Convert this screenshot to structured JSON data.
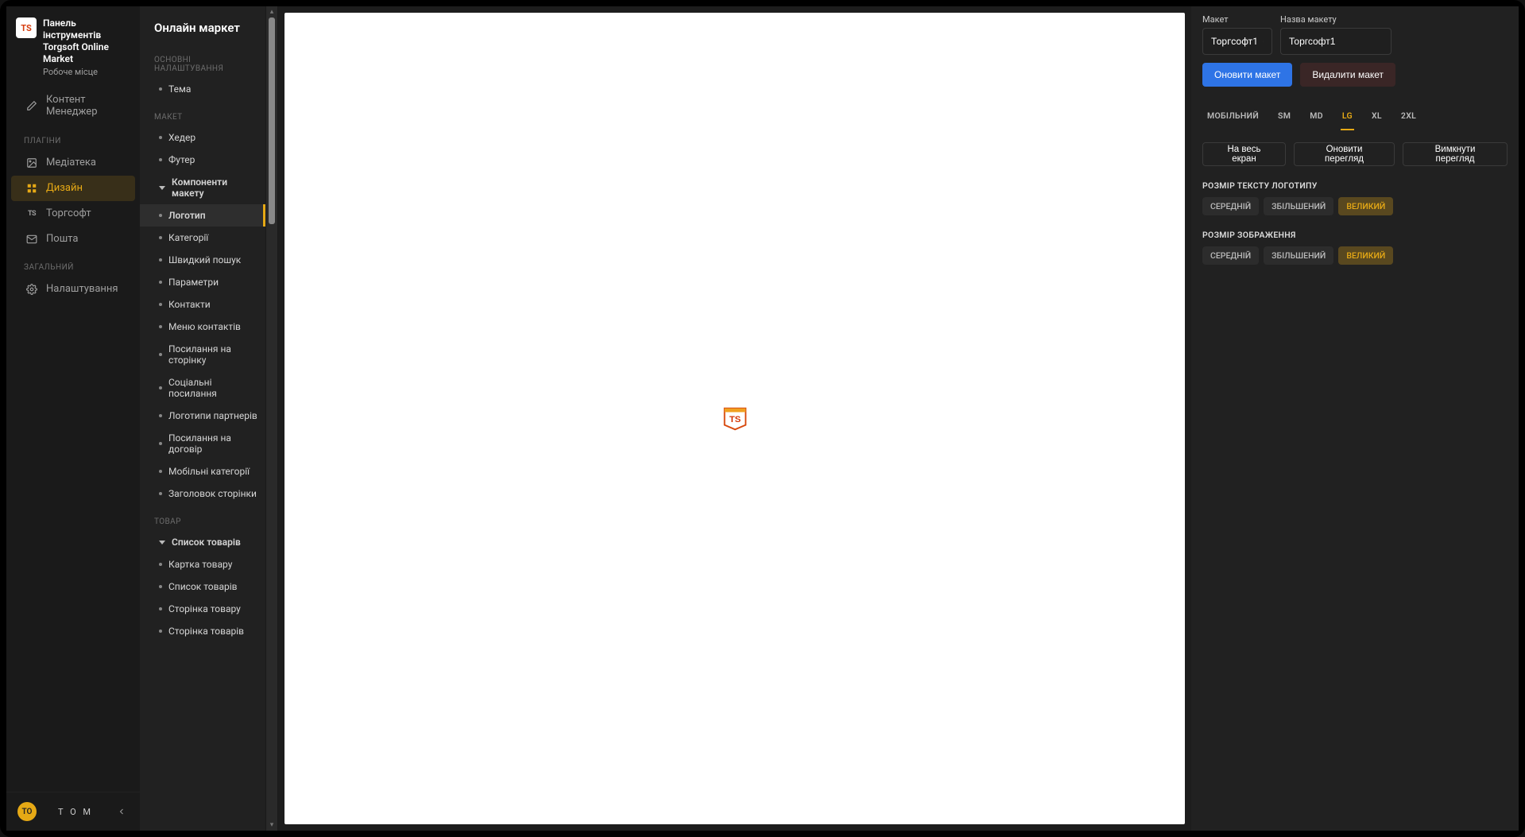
{
  "brand": {
    "logo_text": "TS",
    "title": "Панель інструментів Torgsoft Online Market",
    "subtitle": "Робоче місце"
  },
  "nav_top": {
    "content_manager": "Контент Менеджер"
  },
  "nav_sections": [
    {
      "label": "ПЛАГІНИ",
      "items": [
        {
          "id": "media",
          "label": "Медіатека",
          "icon": "image-icon"
        },
        {
          "id": "design",
          "label": "Дизайн",
          "icon": "layout-icon",
          "active": true
        },
        {
          "id": "torgsoft",
          "label": "Торгсофт",
          "icon": "ts-icon"
        },
        {
          "id": "mail",
          "label": "Пошта",
          "icon": "mail-icon"
        }
      ]
    },
    {
      "label": "ЗАГАЛЬНИЙ",
      "items": [
        {
          "id": "settings",
          "label": "Налаштування",
          "icon": "gear-icon"
        }
      ]
    }
  ],
  "user": {
    "initials": "TO",
    "name": "T O M"
  },
  "subnav": {
    "title": "Онлайн маркет",
    "groups": [
      {
        "label": "ОСНОВНІ НАЛАШТУВАННЯ",
        "items": [
          {
            "id": "theme",
            "label": "Тема"
          }
        ]
      },
      {
        "label": "МАКЕТ",
        "items": [
          {
            "id": "header",
            "label": "Хедер"
          },
          {
            "id": "footer",
            "label": "Футер"
          }
        ]
      },
      {
        "label": "",
        "expandable_header": "Компоненти макету",
        "items": [
          {
            "id": "logo",
            "label": "Логотип",
            "active": true
          },
          {
            "id": "categories",
            "label": "Категорії"
          },
          {
            "id": "quicksearch",
            "label": "Швидкий пошук"
          },
          {
            "id": "params",
            "label": "Параметри"
          },
          {
            "id": "contacts",
            "label": "Контакти"
          },
          {
            "id": "contactmenu",
            "label": "Меню контактів"
          },
          {
            "id": "pagelink",
            "label": "Посилання на сторінку"
          },
          {
            "id": "social",
            "label": "Соціальні посилання"
          },
          {
            "id": "partners",
            "label": "Логотипи партнерів"
          },
          {
            "id": "contract",
            "label": "Посилання на договір"
          },
          {
            "id": "mobcats",
            "label": "Мобільні категорії"
          },
          {
            "id": "pagetitle",
            "label": "Заголовок сторінки"
          }
        ]
      },
      {
        "label": "ТОВАР",
        "expandable_header": "Список товарів",
        "items": [
          {
            "id": "prodcard",
            "label": "Картка товару"
          },
          {
            "id": "prodlist",
            "label": "Список товарів"
          },
          {
            "id": "prodpage",
            "label": "Сторінка товару"
          },
          {
            "id": "prodspage",
            "label": "Сторінка товарів"
          }
        ]
      }
    ]
  },
  "preview": {
    "logo_text": "TS"
  },
  "rightpanel": {
    "form": {
      "layout_label": "Макет",
      "layout_value": "Торгсофт1",
      "layout_name_label": "Назва макету",
      "layout_name_value": "Торгсофт1"
    },
    "actions": {
      "update": "Оновити макет",
      "delete": "Видалити макет"
    },
    "tabs": [
      {
        "id": "mobile",
        "label": "МОБІЛЬНИЙ"
      },
      {
        "id": "sm",
        "label": "SM"
      },
      {
        "id": "md",
        "label": "MD"
      },
      {
        "id": "lg",
        "label": "LG",
        "active": true
      },
      {
        "id": "xl",
        "label": "XL"
      },
      {
        "id": "2xl",
        "label": "2XL"
      }
    ],
    "view_buttons": {
      "fullscreen": "На весь екран",
      "refresh": "Оновити перегляд",
      "toggle_off": "Вимкнути перегляд"
    },
    "settings": [
      {
        "label": "РОЗМІР ТЕКСТУ ЛОГОТИПУ",
        "options": [
          {
            "id": "med",
            "label": "СЕРЕДНІЙ"
          },
          {
            "id": "big",
            "label": "ЗБІЛЬШЕНИЙ"
          },
          {
            "id": "huge",
            "label": "ВЕЛИКИЙ",
            "active": true
          }
        ]
      },
      {
        "label": "РОЗМІР ЗОБРАЖЕННЯ",
        "options": [
          {
            "id": "med",
            "label": "СЕРЕДНІЙ"
          },
          {
            "id": "big",
            "label": "ЗБІЛЬШЕНИЙ"
          },
          {
            "id": "huge",
            "label": "ВЕЛИКИЙ",
            "active": true
          }
        ]
      }
    ]
  }
}
